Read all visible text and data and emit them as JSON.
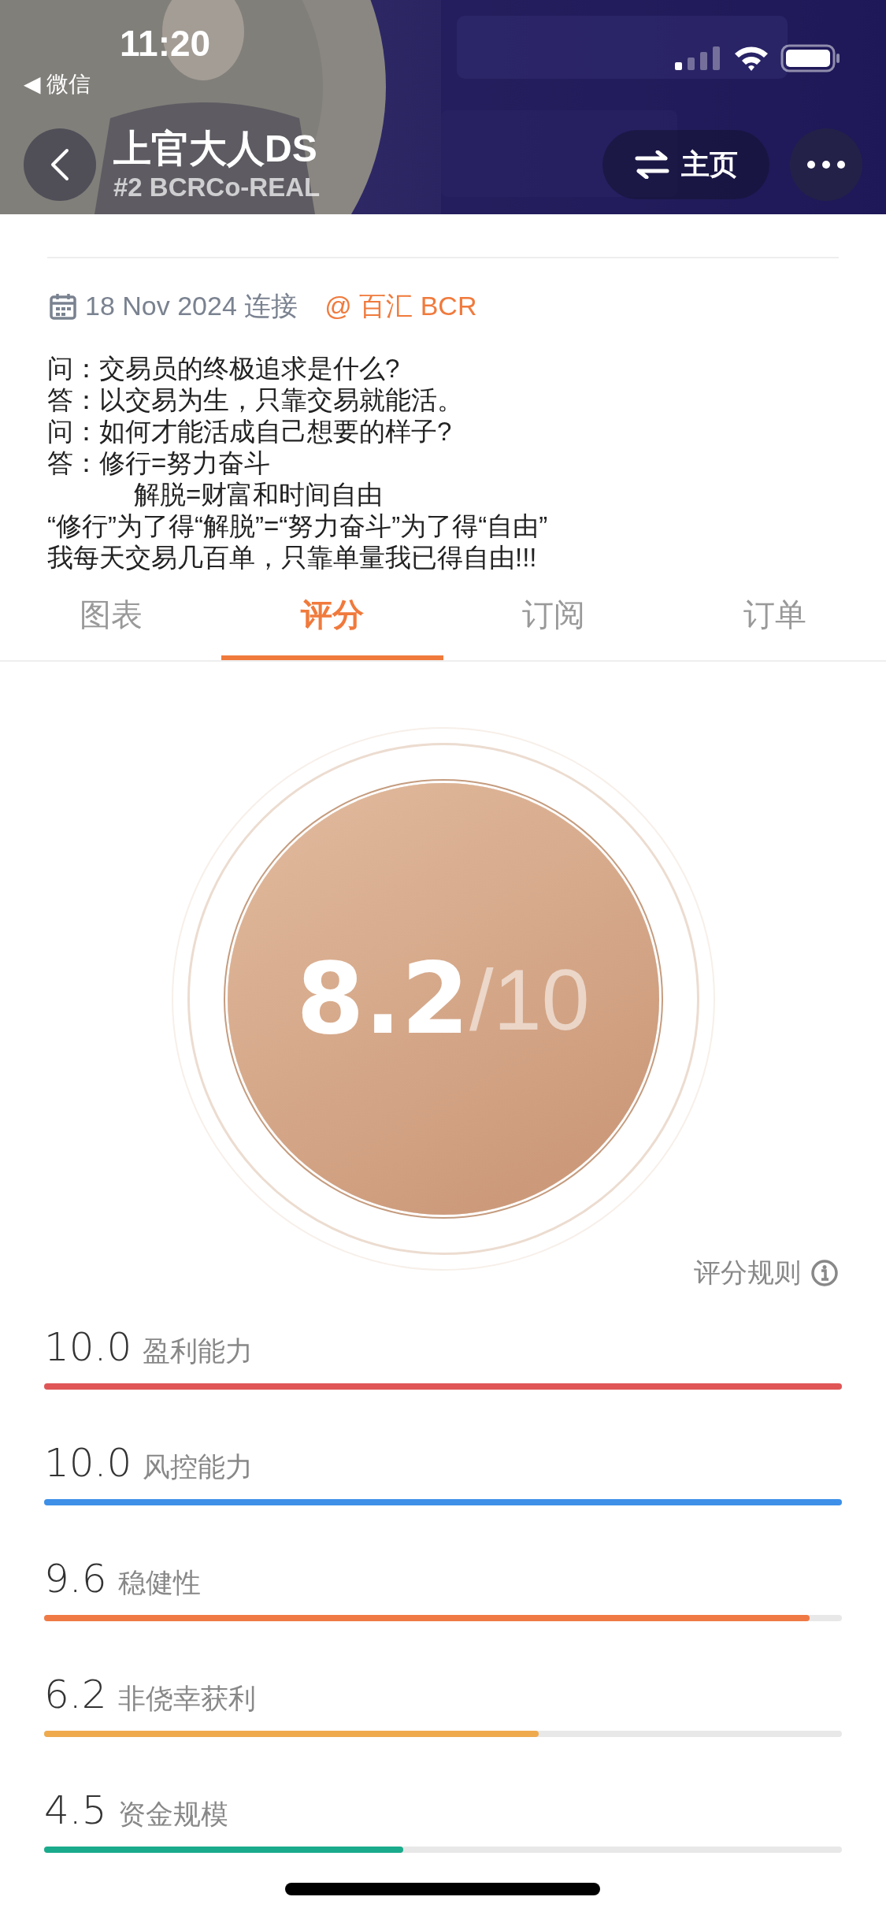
{
  "status_bar": {
    "time": "11:20",
    "back_app": "◀ 微信"
  },
  "header": {
    "title": "上官大人DS",
    "subtitle": "#2 BCRCo-REAL",
    "home_button": "主页"
  },
  "connection": {
    "date": "18 Nov 2024 连接",
    "broker": "@ 百汇 BCR"
  },
  "bio": [
    {
      "text": "问：交易员的终极追求是什么?",
      "indent": false
    },
    {
      "text": "答：以交易为生，只靠交易就能活。",
      "indent": false
    },
    {
      "text": "问：如何才能活成自己想要的样子?",
      "indent": false
    },
    {
      "text": "答：修行=努力奋斗",
      "indent": false
    },
    {
      "text": "解脱=财富和时间自由",
      "indent": true
    },
    {
      "text": "“修行”为了得“解脱”=“努力奋斗”为了得“自由”",
      "indent": false
    },
    {
      "text": "我每天交易几百单，只靠单量我已得自由!!!",
      "indent": false
    }
  ],
  "tabs": [
    {
      "label": "图表",
      "selected": false
    },
    {
      "label": "评分",
      "selected": true
    },
    {
      "label": "订阅",
      "selected": false
    },
    {
      "label": "订单",
      "selected": false
    }
  ],
  "rating": {
    "score": "8.2",
    "max": "/10",
    "rules_link": "评分规则"
  },
  "scores": [
    {
      "value": "10.0",
      "label": "盈利能力",
      "level": 1.0,
      "color": "#e05656"
    },
    {
      "value": "10.0",
      "label": "风控能力",
      "level": 1.0,
      "color": "#3d8fe8"
    },
    {
      "value": "9.6",
      "label": "稳健性",
      "level": 0.96,
      "color": "#f07a45"
    },
    {
      "value": "6.2",
      "label": "非侥幸获利",
      "level": 0.62,
      "color": "#efaa4e"
    },
    {
      "value": "4.5",
      "label": "资金规模",
      "level": 0.45,
      "color": "#1aab8c"
    }
  ]
}
